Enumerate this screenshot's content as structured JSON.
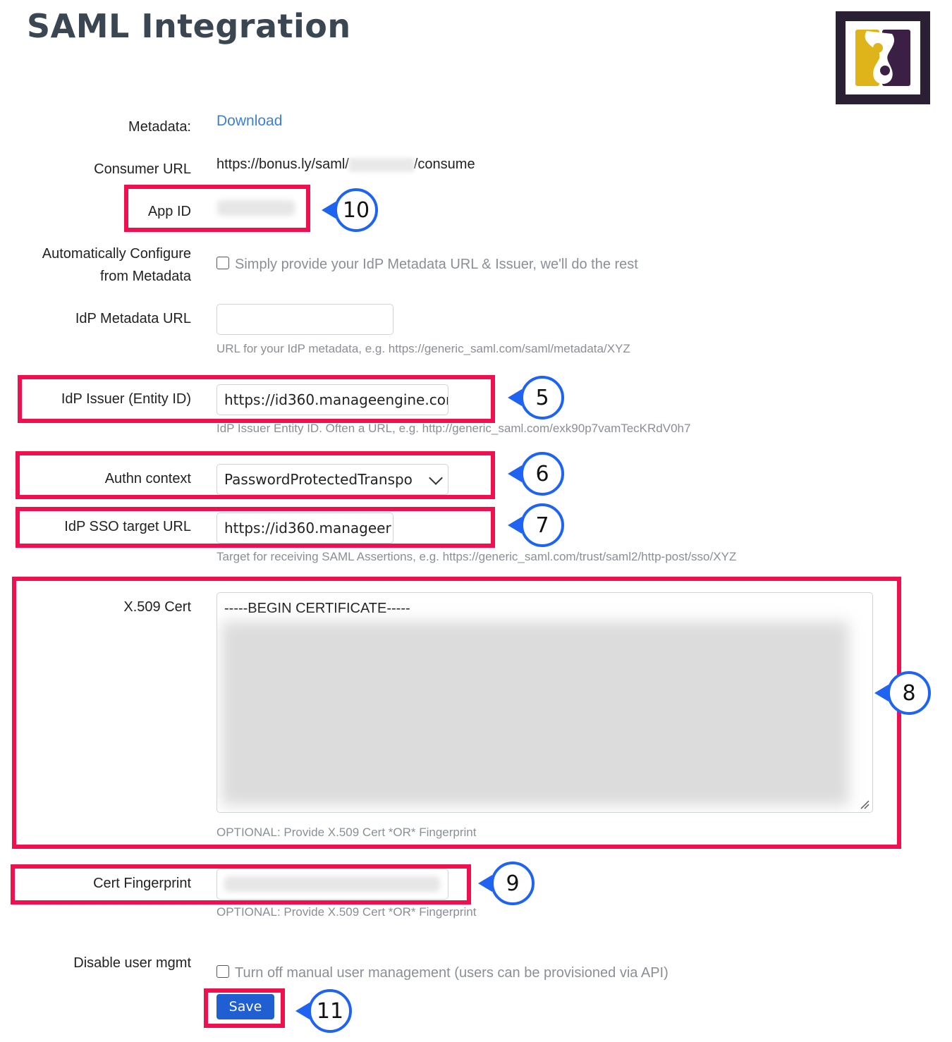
{
  "page": {
    "title": "SAML Integration"
  },
  "metadata": {
    "label": "Metadata:",
    "link": "Download"
  },
  "consumer_url": {
    "label": "Consumer URL",
    "prefix": "https://bonus.ly/saml/",
    "suffix": "/consume"
  },
  "app_id": {
    "label": "App ID"
  },
  "auto_configure": {
    "label_line1": "Automatically Configure",
    "label_line2": "from Metadata",
    "checkbox_label": "Simply provide your IdP Metadata URL & Issuer, we'll do the rest",
    "checked": false
  },
  "idp_metadata_url": {
    "label": "IdP Metadata URL",
    "value": "",
    "help": "URL for your IdP metadata, e.g. https://generic_saml.com/saml/metadata/XYZ"
  },
  "idp_issuer": {
    "label": "IdP Issuer (Entity ID)",
    "value": "https://id360.manageengine.cor",
    "help": "IdP Issuer Entity ID. Often a URL, e.g. http://generic_saml.com/exk90p7vamTecKRdV0h7"
  },
  "authn_context": {
    "label": "Authn context",
    "selected": "PasswordProtectedTranspo"
  },
  "idp_sso_target_url": {
    "label": "IdP SSO target URL",
    "value": "https://id360.manageer",
    "help": "Target for receiving SAML Assertions, e.g. https://generic_saml.com/trust/saml2/http-post/sso/XYZ"
  },
  "x509_cert": {
    "label": "X.509 Cert",
    "value": "-----BEGIN CERTIFICATE-----",
    "help": "OPTIONAL: Provide X.509 Cert *OR* Fingerprint"
  },
  "cert_fingerprint": {
    "label": "Cert Fingerprint",
    "help": "OPTIONAL: Provide X.509 Cert *OR* Fingerprint"
  },
  "disable_user_mgmt": {
    "label": "Disable user mgmt",
    "checkbox_label": "Turn off manual user management (users can be provisioned via API)",
    "checked": false
  },
  "save_button": {
    "label": "Save"
  },
  "callouts": {
    "c5": "5",
    "c6": "6",
    "c7": "7",
    "c8": "8",
    "c9": "9",
    "c10": "10",
    "c11": "11"
  },
  "colors": {
    "highlight": "#f0104f",
    "callout_border": "#1f63f2",
    "link": "#3b7fd6",
    "save_button": "#1f5fd1",
    "title": "#3a4652"
  },
  "icons": {
    "logo": "bonusly-logo-icon",
    "select": "chevron-down-icon",
    "resize": "resize-handle-icon"
  }
}
